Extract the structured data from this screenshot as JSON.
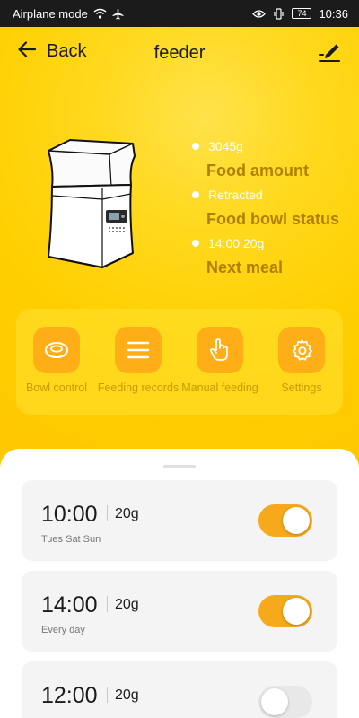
{
  "status_bar": {
    "network_text": "Airplane mode",
    "battery": "74",
    "time": "10:36",
    "icons": [
      "wifi-icon",
      "airplane-icon",
      "eye-icon",
      "vibrate-icon",
      "battery-icon"
    ]
  },
  "header": {
    "back_label": "Back",
    "title": "feeder",
    "edit_icon": "edit-icon"
  },
  "device_info": [
    {
      "value": "3045g",
      "label": "Food amount"
    },
    {
      "value": "Retracted",
      "label": "Food bowl status"
    },
    {
      "value": "14:00 20g",
      "label": "Next meal"
    }
  ],
  "actions": [
    {
      "label": "Bowl control",
      "icon": "bowl-icon"
    },
    {
      "label": "Feeding records",
      "icon": "list-icon"
    },
    {
      "label": "Manual feeding",
      "icon": "hand-icon"
    },
    {
      "label": "Settings",
      "icon": "gear-icon"
    }
  ],
  "meals": [
    {
      "time": "10:00",
      "amount": "20g",
      "days": "Tues Sat Sun",
      "enabled": true
    },
    {
      "time": "14:00",
      "amount": "20g",
      "days": "Every day",
      "enabled": true
    },
    {
      "time": "12:00",
      "amount": "20g",
      "days": "",
      "enabled": false
    }
  ],
  "colors": {
    "background": "#FFD400",
    "accent": "#F6A91A",
    "label": "#B07F00",
    "action_icon_bg": "#FFAE17"
  }
}
